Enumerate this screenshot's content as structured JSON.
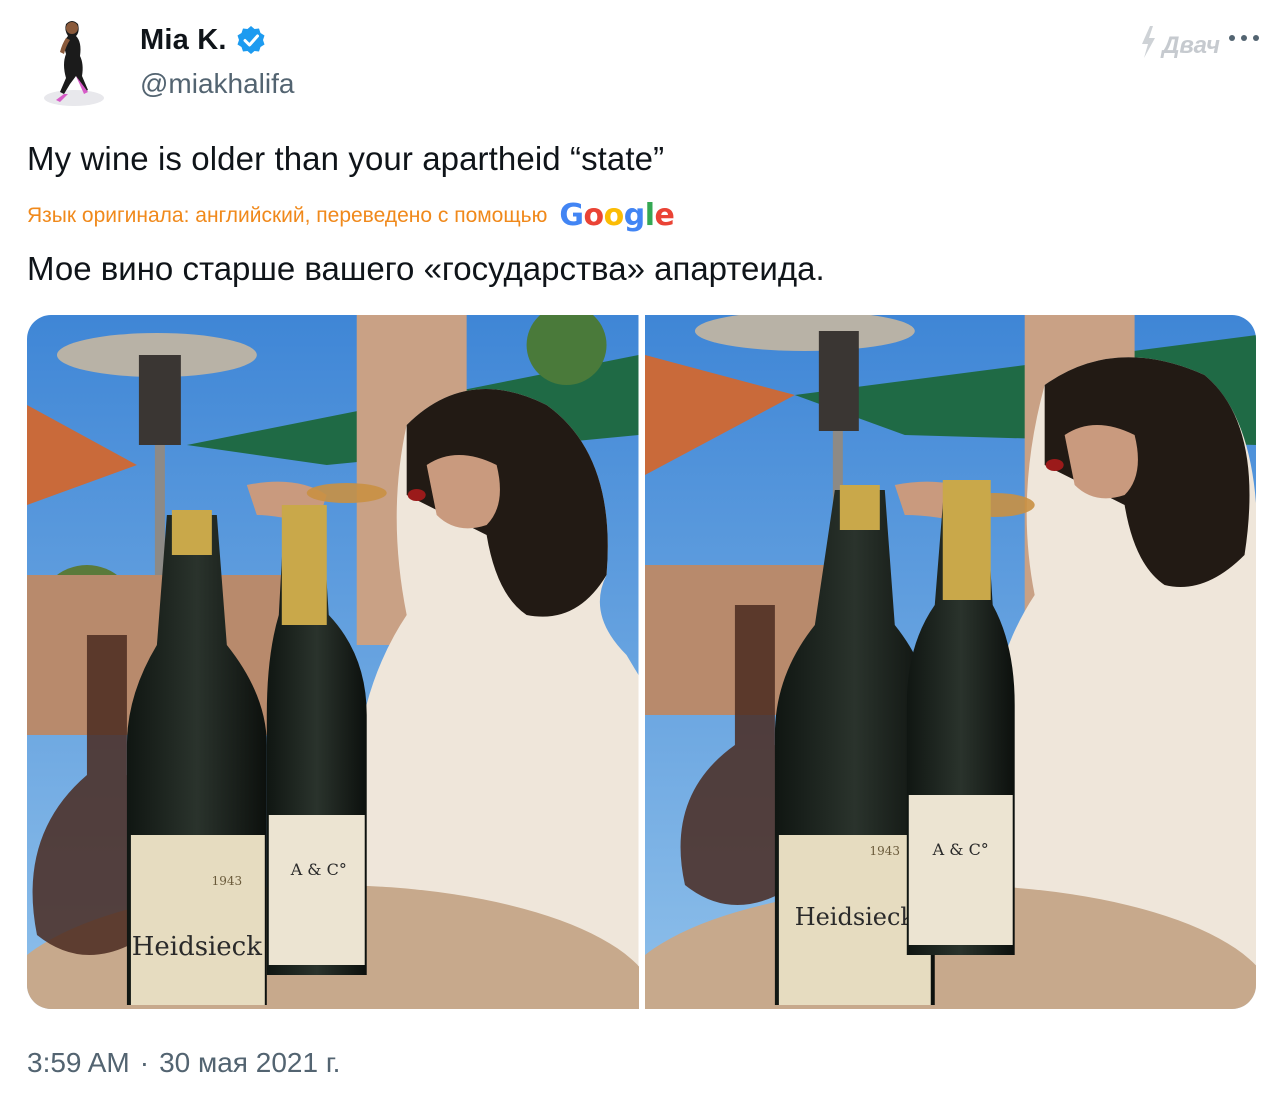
{
  "author": {
    "display_name": "Mia K.",
    "handle": "@miakhalifa",
    "verified": true,
    "verified_color": "#1d9bf0"
  },
  "watermark": {
    "text": "Двач"
  },
  "tweet": {
    "text": "My wine is older than your apartheid “state”",
    "translation_label": "Язык оригинала: английский, переведено с помощью",
    "translation_provider": "Google",
    "translated_text": "Мое вино старше вашего «государства» апартеида."
  },
  "media": [
    {
      "label": "1943",
      "brand": "Heidsieck",
      "secondary_label": "A & C°"
    },
    {
      "label": "1943",
      "brand": "Heidsieck",
      "secondary_label": "A & C°"
    }
  ],
  "timestamp": {
    "time": "3:59 AM",
    "separator": "·",
    "date": "30 мая 2021 г."
  },
  "colors": {
    "text_primary": "#0f1419",
    "text_secondary": "#536471",
    "translation_accent": "#f0891b"
  },
  "icons": [
    "verified-badge-icon",
    "more-options-icon",
    "lightning-watermark-icon"
  ]
}
